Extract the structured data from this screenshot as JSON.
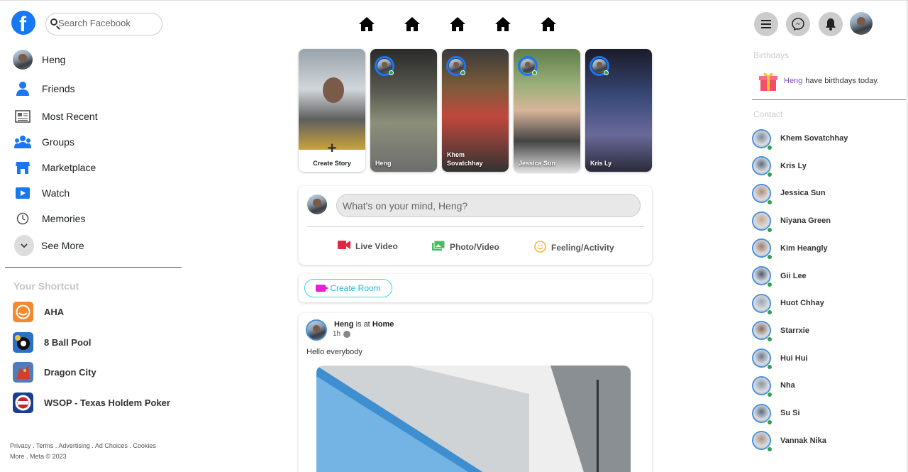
{
  "header": {
    "logo_letter": "f",
    "search_placeholder": "Search Facebook"
  },
  "sidebar": {
    "items": [
      {
        "label": "Heng",
        "icon": "profile-avatar"
      },
      {
        "label": "Friends",
        "icon": "friends-icon"
      },
      {
        "label": "Most Recent",
        "icon": "news-feed-icon"
      },
      {
        "label": "Groups",
        "icon": "groups-icon"
      },
      {
        "label": "Marketplace",
        "icon": "marketplace-icon"
      },
      {
        "label": "Watch",
        "icon": "watch-icon"
      },
      {
        "label": "Memories",
        "icon": "clock-icon"
      },
      {
        "label": "See More",
        "icon": "chevron-down-icon"
      }
    ],
    "shortcut_title": "Your Shortcut",
    "shortcuts": [
      {
        "label": "AHA",
        "color": "#f4892f"
      },
      {
        "label": "8 Ball Pool",
        "color": "#2d6fc4"
      },
      {
        "label": "Dragon City",
        "color": "#4c7fb8"
      },
      {
        "label": "WSOP - Texas Holdem Poker",
        "color": "#1b3f8b"
      }
    ],
    "footer_line1": "Privacy . Terms . Advertising . Ad Choices . Cookies",
    "footer_line2": "More . Meta © 2023"
  },
  "stories": {
    "create_label": "Create Story",
    "items": [
      {
        "name": "Heng"
      },
      {
        "name": "Khem Sovatchhay"
      },
      {
        "name": "Jessica Sun"
      },
      {
        "name": "Kris Ly"
      }
    ]
  },
  "composer": {
    "placeholder": "What's on your mind, Heng?",
    "actions": [
      {
        "label": "Live Video",
        "color": "#e42645"
      },
      {
        "label": "Photo/Video",
        "color": "#45bd62"
      },
      {
        "label": "Feeling/Activity",
        "color": "#f7b928"
      }
    ]
  },
  "room": {
    "label": "Create Room"
  },
  "post": {
    "author": "Heng",
    "middle": "is at",
    "place": "Home",
    "time": "1h",
    "text": "Hello everybody"
  },
  "right": {
    "birthdays_title": "Birthdays",
    "birthday_name": "Heng",
    "birthday_text": "have birthdays today.",
    "contact_title": "Contact",
    "contacts": [
      "Khem Sovatchhay",
      "Kris Ly",
      "Jessica Sun",
      "Niyana Green",
      "Kim Heangly",
      "Gii Lee",
      "Huot Chhay",
      "Starrxie",
      "Hui Hui",
      "Nha",
      "Su Si",
      "Vannak Nika"
    ]
  },
  "colors": {
    "brand": "#1877f2",
    "online": "#31a24c"
  }
}
